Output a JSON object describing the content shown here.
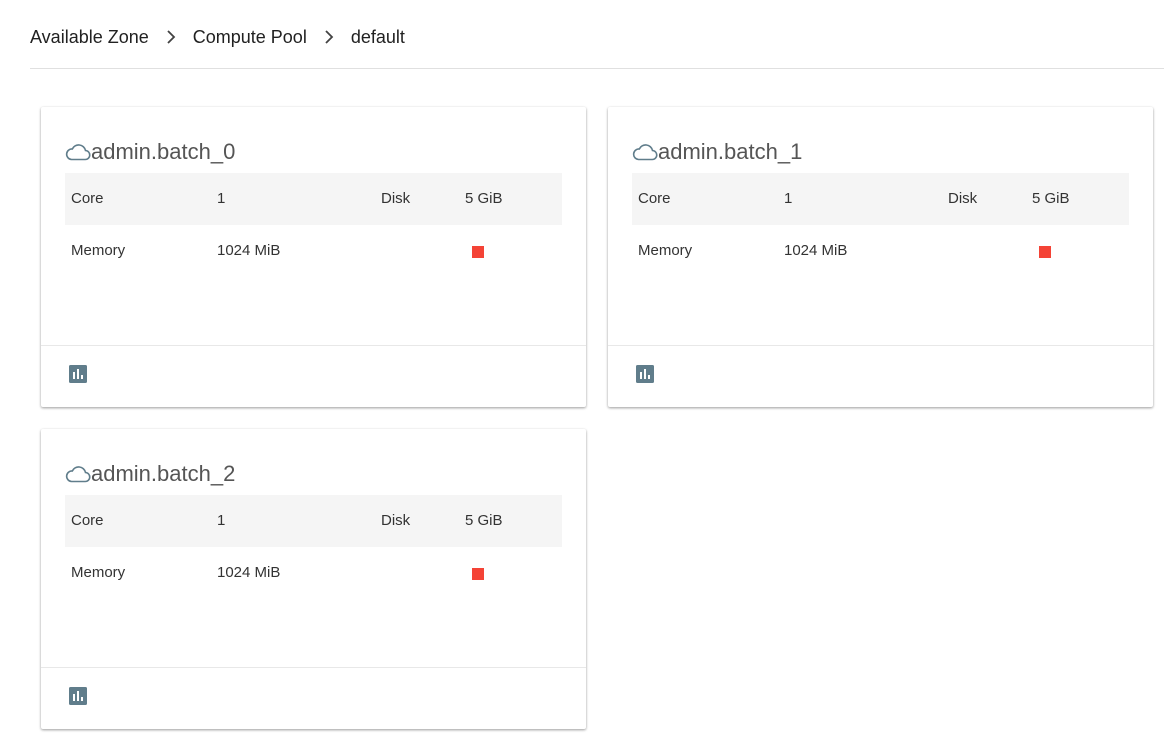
{
  "breadcrumb": {
    "items": [
      "Available Zone",
      "Compute Pool",
      "default"
    ]
  },
  "cards": [
    {
      "name": "admin.batch_0",
      "core_label": "Core",
      "core_value": "1",
      "disk_label": "Disk",
      "disk_value": "5 GiB",
      "memory_label": "Memory",
      "memory_value": "1024 MiB",
      "status_color": "#f44336"
    },
    {
      "name": "admin.batch_1",
      "core_label": "Core",
      "core_value": "1",
      "disk_label": "Disk",
      "disk_value": "5 GiB",
      "memory_label": "Memory",
      "memory_value": "1024 MiB",
      "status_color": "#f44336"
    },
    {
      "name": "admin.batch_2",
      "core_label": "Core",
      "core_value": "1",
      "disk_label": "Disk",
      "disk_value": "5 GiB",
      "memory_label": "Memory",
      "memory_value": "1024 MiB",
      "status_color": "#f44336"
    }
  ],
  "icons": {
    "cloud": "cloud-icon",
    "chart": "bar-chart-icon",
    "separator": "chevron-right-icon"
  },
  "colors": {
    "status_stopped": "#f44336",
    "icon": "#607d8b",
    "row_shade": "#f5f5f5"
  }
}
